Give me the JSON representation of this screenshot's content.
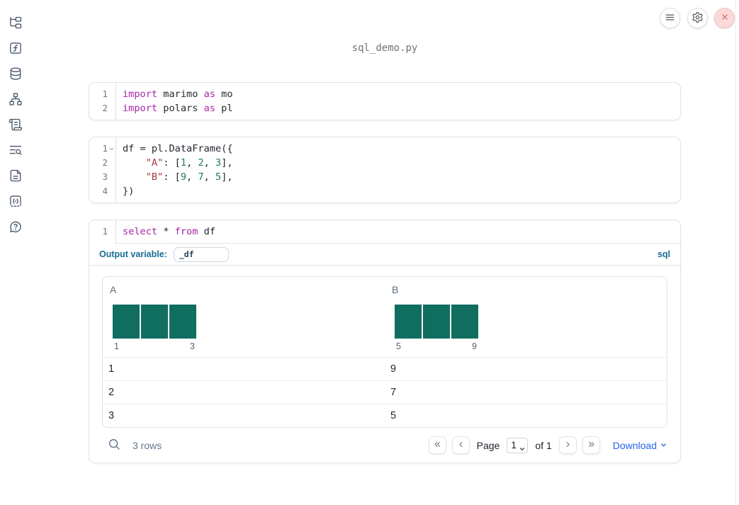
{
  "app": {
    "title": "sql_demo.py"
  },
  "sidebar": {
    "items": [
      {
        "icon": "file-explorer-tree-icon"
      },
      {
        "icon": "function-square-icon"
      },
      {
        "icon": "database-icon"
      },
      {
        "icon": "dependency-graph-icon"
      },
      {
        "icon": "scratchpad-scroll-icon"
      },
      {
        "icon": "logs-search-icon"
      },
      {
        "icon": "documentation-file-icon"
      },
      {
        "icon": "snippets-code-icon"
      },
      {
        "icon": "help-bubble-icon"
      }
    ]
  },
  "topbar": {
    "buttons": [
      {
        "icon": "hamburger-menu-icon"
      },
      {
        "icon": "gear-icon"
      },
      {
        "icon": "close-x-icon"
      }
    ]
  },
  "cells": [
    {
      "id": "imports",
      "lines": [
        {
          "num": "1",
          "tokens": [
            [
              "kw",
              "import"
            ],
            [
              "pl",
              " marimo "
            ],
            [
              "kw",
              "as"
            ],
            [
              "pl",
              " mo"
            ]
          ]
        },
        {
          "num": "2",
          "tokens": [
            [
              "kw",
              "import"
            ],
            [
              "pl",
              " polars "
            ],
            [
              "kw",
              "as"
            ],
            [
              "pl",
              " pl"
            ]
          ]
        }
      ]
    },
    {
      "id": "dataframe",
      "lines": [
        {
          "num": "1",
          "fold": true,
          "tokens": [
            [
              "pl",
              "df = pl.DataFrame({"
            ]
          ]
        },
        {
          "num": "2",
          "tokens": [
            [
              "pl",
              "    "
            ],
            [
              "str",
              "\"A\""
            ],
            [
              "pl",
              ": ["
            ],
            [
              "num",
              "1"
            ],
            [
              "pl",
              ", "
            ],
            [
              "num",
              "2"
            ],
            [
              "pl",
              ", "
            ],
            [
              "num",
              "3"
            ],
            [
              "pl",
              "],"
            ]
          ]
        },
        {
          "num": "3",
          "tokens": [
            [
              "pl",
              "    "
            ],
            [
              "str",
              "\"B\""
            ],
            [
              "pl",
              ": ["
            ],
            [
              "num",
              "9"
            ],
            [
              "pl",
              ", "
            ],
            [
              "num",
              "7"
            ],
            [
              "pl",
              ", "
            ],
            [
              "num",
              "5"
            ],
            [
              "pl",
              "],"
            ]
          ]
        },
        {
          "num": "4",
          "tokens": [
            [
              "pl",
              "})"
            ]
          ]
        }
      ]
    },
    {
      "id": "sql",
      "lines": [
        {
          "num": "1",
          "tokens": [
            [
              "kw",
              "select"
            ],
            [
              "pl",
              " * "
            ],
            [
              "kw",
              "from"
            ],
            [
              "pl",
              " df"
            ]
          ]
        }
      ]
    }
  ],
  "sql_cell": {
    "output_variable_label": "Output variable:",
    "output_variable_value": "_df",
    "language_badge": "sql"
  },
  "table": {
    "columns": [
      {
        "label": "A",
        "histogram": {
          "bars": [
            1,
            1,
            1
          ],
          "min_label": "1",
          "max_label": "3"
        }
      },
      {
        "label": "B",
        "histogram": {
          "bars": [
            1,
            1,
            1
          ],
          "min_label": "5",
          "max_label": "9"
        }
      }
    ],
    "rows": [
      [
        "1",
        "9"
      ],
      [
        "2",
        "7"
      ],
      [
        "3",
        "5"
      ]
    ],
    "footer": {
      "row_count": "3 rows",
      "page_label": "Page",
      "page_value": "1",
      "of_label": "of 1",
      "download_label": "Download"
    }
  },
  "colors": {
    "accent_blue": "#156e94",
    "keyword": "#a626a4",
    "string": "#a8383e",
    "number": "#1c7d4a",
    "histogram_bar": "#0f6e5f",
    "download_link": "#2563eb",
    "close_button_icon": "#d66a6a"
  }
}
